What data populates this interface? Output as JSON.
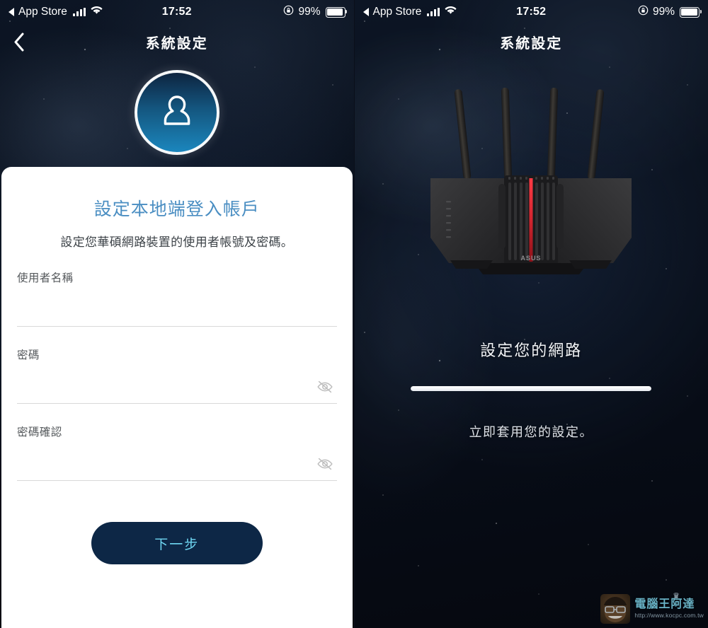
{
  "colors": {
    "accent_blue": "#4a8ec2",
    "button_bg": "#0d2746",
    "button_text": "#6fd7f2",
    "card_bg": "#ffffff",
    "avatar_gradient_top": "#0d2440",
    "avatar_gradient_bottom": "#1b86bd",
    "router_accent_red": "#d2252f"
  },
  "left_panel": {
    "statusbar": {
      "back_app": "App Store",
      "back_icon": "triangle-left-icon",
      "signal_icon": "cellular-bars-icon",
      "wifi_icon": "wifi-icon",
      "time": "17:52",
      "rotation_lock_icon": "rotation-lock-icon",
      "battery_percent": "99%",
      "battery_icon": "battery-icon"
    },
    "nav": {
      "back_icon": "chevron-left-icon",
      "title": "系統設定"
    },
    "avatar": {
      "icon": "user-avatar-icon"
    },
    "card": {
      "title": "設定本地端登入帳戶",
      "subtitle": "設定您華碩網路裝置的使用者帳號及密碼。",
      "fields": [
        {
          "label": "使用者名稱",
          "value": "",
          "placeholder": "",
          "has_eye": false
        },
        {
          "label": "密碼",
          "value": "",
          "placeholder": "",
          "has_eye": true,
          "eye_icon": "eye-off-icon"
        },
        {
          "label": "密碼確認",
          "value": "",
          "placeholder": "",
          "has_eye": true,
          "eye_icon": "eye-off-icon"
        }
      ],
      "next_button": "下一步"
    }
  },
  "right_panel": {
    "statusbar": {
      "back_app": "App Store",
      "back_icon": "triangle-left-icon",
      "signal_icon": "cellular-bars-icon",
      "wifi_icon": "wifi-icon",
      "time": "17:52",
      "rotation_lock_icon": "rotation-lock-icon",
      "battery_percent": "99%",
      "battery_icon": "battery-icon"
    },
    "nav": {
      "title": "系統設定"
    },
    "hero": {
      "image": "asus-router-illustration",
      "brand_label": "ASUS",
      "antenna_count": 4
    },
    "status_title": "設定您的網路",
    "progress_percent": 100,
    "status_subtitle": "立即套用您的設定。"
  },
  "watermark": {
    "title": "電腦王阿達",
    "url": "http://www.kocpc.com.tw",
    "face_icon": "avatar-face-icon",
    "crown_icon": "crown-icon"
  }
}
